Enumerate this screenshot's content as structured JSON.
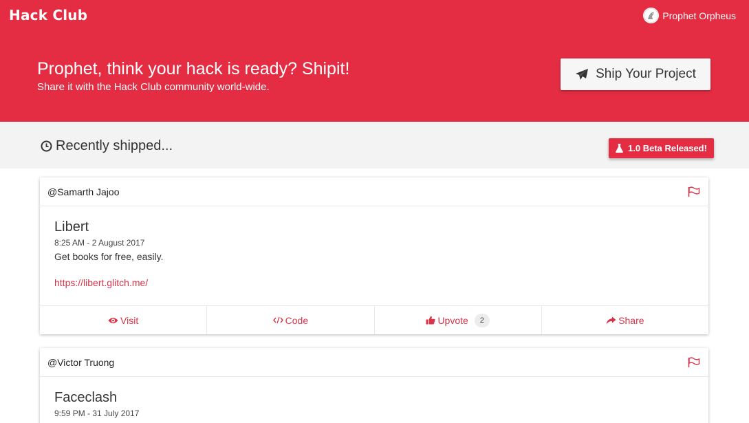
{
  "brand": "Hack Club",
  "user": {
    "name": "Prophet Orpheus",
    "avatar_icon": "dinosaur-avatar-icon"
  },
  "hero": {
    "title": "Prophet, think your hack is ready? Shipit!",
    "subtitle": "Share it with the Hack Club community world-wide.",
    "ship_button": "Ship Your Project",
    "ship_icon": "paper-plane-icon"
  },
  "feed": {
    "heading": "Recently shipped...",
    "heading_icon": "clock-icon",
    "beta_label": "1.0 Beta Released!",
    "beta_icon": "flask-icon"
  },
  "posts": [
    {
      "author": "@Samarth Jajoo",
      "title": "Libert",
      "time": "8:25 AM - 2 August 2017",
      "description": "Get books for free, easily.",
      "link": "https://libert.glitch.me/",
      "actions": {
        "visit": "Visit",
        "code": "Code",
        "upvote": "Upvote",
        "upvote_count": "2",
        "share": "Share"
      }
    },
    {
      "author": "@Victor Truong",
      "title": "Faceclash",
      "time": "9:59 PM - 31 July 2017"
    }
  ],
  "colors": {
    "brand": "#e42d42",
    "link": "#d83348",
    "subbar": "#f3f3f3"
  }
}
